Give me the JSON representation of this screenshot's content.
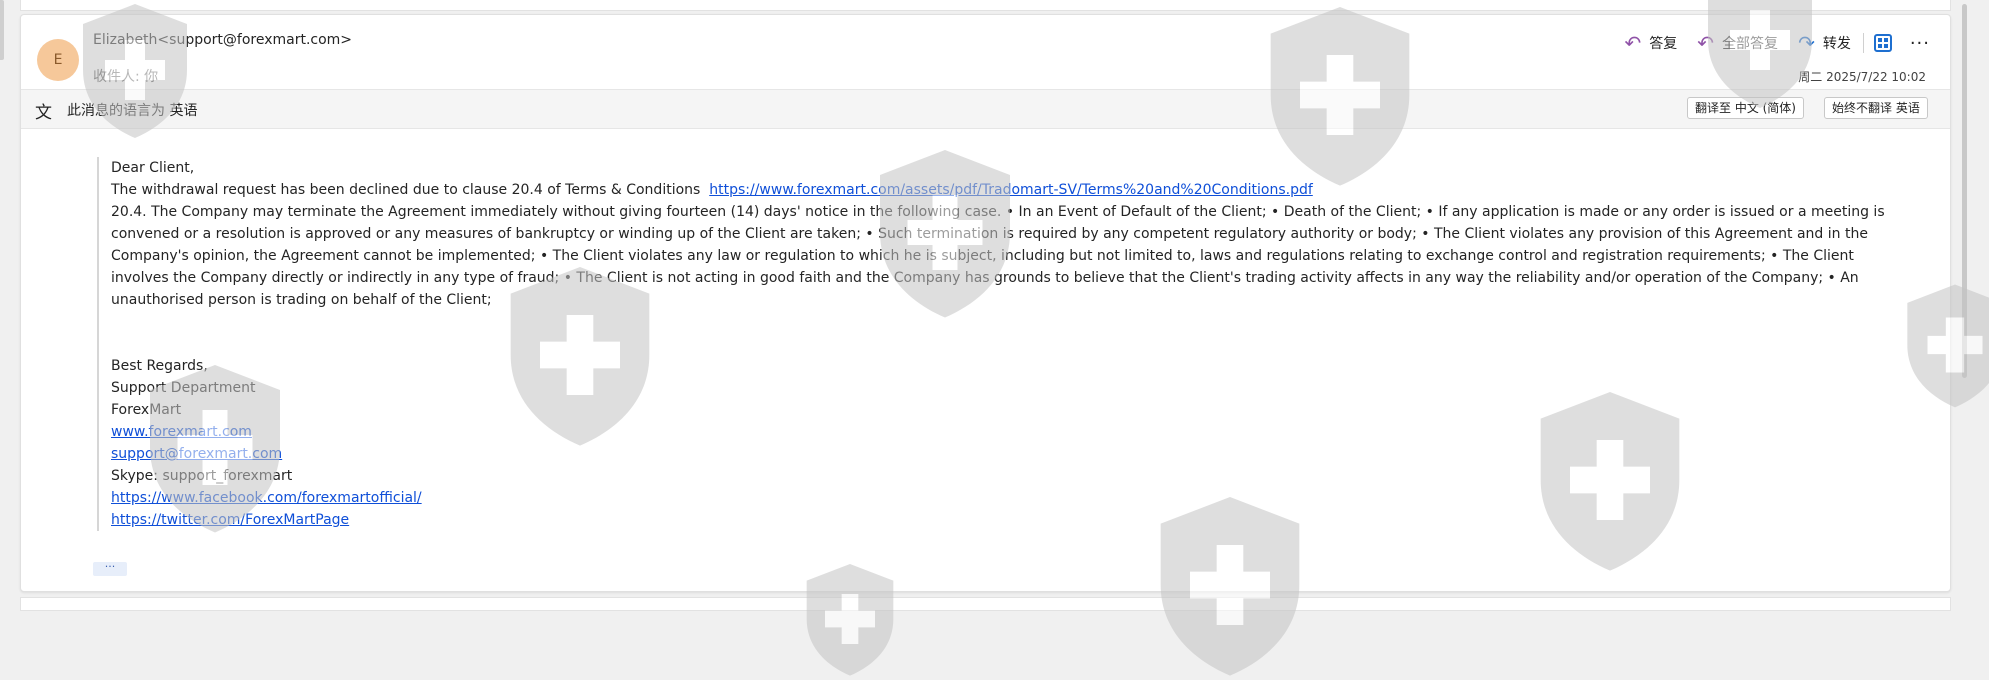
{
  "email": {
    "avatar_initial": "E",
    "sender": "Elizabeth<support@forexmart.com>",
    "recipient": "收件人:  你",
    "date": "周二 2025/7/22 10:02",
    "actions": {
      "reply": "答复",
      "reply_all": "全部答复",
      "forward": "转发",
      "more": "···"
    },
    "translate": {
      "message": "此消息的语言为 英语",
      "translate_btn": "翻译至 中文 (简体)",
      "never_btn": "始终不翻译 英语"
    },
    "body": {
      "greeting": "Dear Client,",
      "line1": "The withdrawal request has been declined  due to clause 20.4 of Terms & Conditions",
      "link_terms": "https://www.forexmart.com/assets/pdf/Tradomart-SV/Terms%20and%20Conditions.pdf",
      "clause": "20.4. The Company may terminate the Agreement immediately without giving fourteen (14) days' notice in the following case. • In an Event of Default of the Client; • Death of the Client; • If any application is made or any order is issued or a meeting is convened or a resolution is approved or any measures of bankruptcy or winding up of the Client are taken; • Such termination is required by any competent regulatory authority or body; • The Client violates any provision of this Agreement and in the Company's opinion, the Agreement cannot be implemented; • The Client violates any law or regulation to which he is subject, including but not limited to, laws and regulations relating to exchange control and registration requirements; • The Client involves the Company directly or indirectly in any type of fraud; • The Client is not acting in good faith and the Company has grounds to believe that the Client's trading activity affects in any way the reliability and/or operation of the Company; • An unauthorised person is trading on behalf of the Client;",
      "regards": "Best Regards,",
      "dept": "Support Department",
      "company": "ForexMart",
      "website": "www.forexmart.com",
      "support_email": "support@forexmart.com",
      "skype": "Skype: support_forexmart",
      "facebook": "https://www.facebook.com/forexmartofficial/",
      "twitter": "https://twitter.com/ForexMartPage"
    },
    "show_more": "···"
  },
  "colors": {
    "reply_icon": "#8f52a7",
    "forward_icon": "#1e6fd0",
    "link": "#0f4fd8",
    "avatar_bg": "#f6c89a"
  },
  "icons": {
    "reply": "reply-arrow-icon",
    "reply_all": "reply-all-arrow-icon",
    "forward": "forward-arrow-icon",
    "immersive_reader": "immersive-reader-icon",
    "translate": "translate-icon",
    "watermark": "shield-cross-icon"
  }
}
